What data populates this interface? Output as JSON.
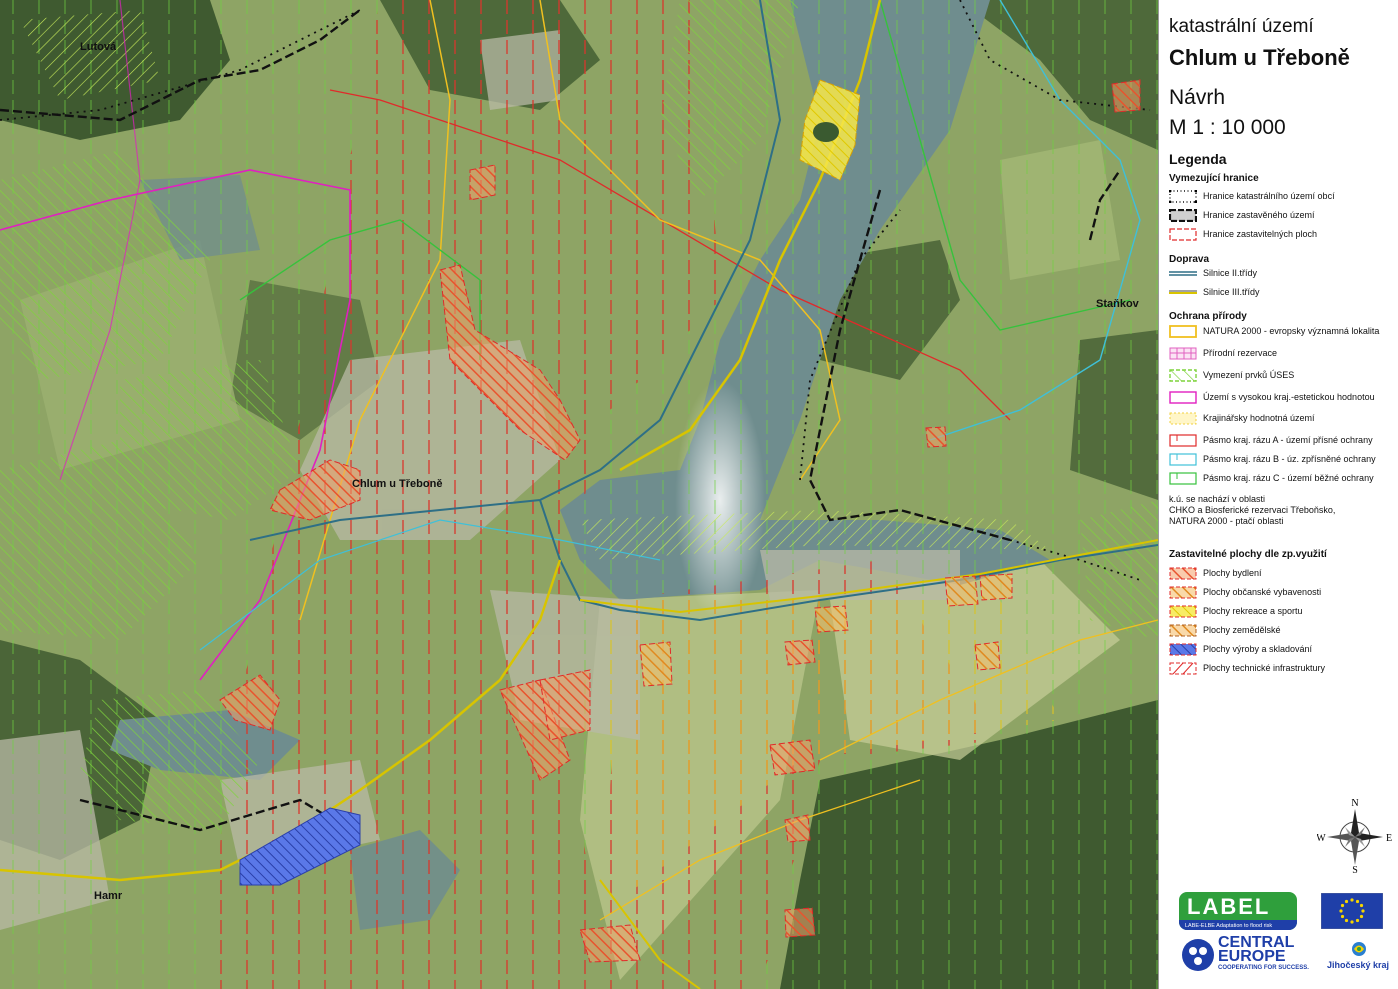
{
  "map": {
    "places": [
      {
        "name": "Lutová"
      },
      {
        "name": "Chlum u Třeboně"
      },
      {
        "name": "Staňkov"
      },
      {
        "name": "Hamr"
      }
    ]
  },
  "header": {
    "line1": "katastrální území",
    "line2": "Chlum u Třeboně",
    "line3": "Návrh",
    "line4": "M 1 : 10 000"
  },
  "legend": {
    "title": "Legenda",
    "sections": [
      {
        "title": "Vymezující hranice",
        "items": [
          {
            "label": "Hranice katastrálního území obcí",
            "symbol": "cadastral-boundary"
          },
          {
            "label": "Hranice zastavěného území",
            "symbol": "built-up-boundary"
          },
          {
            "label": "Hranice zastavitelných ploch",
            "symbol": "buildable-boundary"
          }
        ]
      },
      {
        "title": "Doprava",
        "items": [
          {
            "label": "Silnice II.třídy",
            "symbol": "road-class-2"
          },
          {
            "label": "Silnice III.třídy",
            "symbol": "road-class-3"
          }
        ]
      },
      {
        "title": "Ochrana přírody",
        "items": [
          {
            "label": "NATURA 2000 - evropsky významná lokalita",
            "symbol": "natura-2000"
          },
          {
            "label": "Přírodní rezervace",
            "symbol": "nature-reserve"
          },
          {
            "label": "Vymezení prvků ÚSES",
            "symbol": "uses-elements"
          },
          {
            "label": "Území s vysokou kraj.-estetickou hodnotou",
            "symbol": "aesthetic-value-area"
          },
          {
            "label": "Krajinářsky hodnotná území",
            "symbol": "landscape-valuable-area"
          },
          {
            "label": "Pásmo kraj. rázu A - území přísné ochrany",
            "symbol": "zone-a"
          },
          {
            "label": "Pásmo kraj. rázu B - úz. zpřísněné ochrany",
            "symbol": "zone-b"
          },
          {
            "label": "Pásmo kraj. rázu C - území běžné ochrany",
            "symbol": "zone-c"
          }
        ]
      },
      {
        "title": "Zastavitelné plochy dle zp.využití",
        "items": [
          {
            "label": "Plochy bydlení",
            "symbol": "housing"
          },
          {
            "label": "Plochy občanské vybavenosti",
            "symbol": "civic-amenities"
          },
          {
            "label": "Plochy rekreace a sportu",
            "symbol": "recreation-sport"
          },
          {
            "label": "Plochy zemědělské",
            "symbol": "agricultural"
          },
          {
            "label": "Plochy výroby a skladování",
            "symbol": "production-storage"
          },
          {
            "label": "Plochy  technické infrastruktury",
            "symbol": "technical-infrastructure"
          }
        ]
      }
    ],
    "note": "k.ú. se nachází v oblasti\nCHKO a Biosferické rezervaci Třeboňsko,\nNATURA 2000 - ptačí oblasti"
  },
  "compass": {
    "n": "N",
    "s": "S",
    "e": "E",
    "w": "W"
  },
  "logos": {
    "label_name": "LABEL",
    "label_subtitle": "LABE-ELBE Adaptation to flood risk",
    "central_europe_line1": "CENTRAL",
    "central_europe_line2": "EUROPE",
    "central_europe_line3": "COOPERATING FOR SUCCESS.",
    "region": "Jihočeský kraj"
  },
  "colors": {
    "housing": "#e8542e",
    "civic": "#f0a030",
    "recreation": "#f7e84a",
    "agricultural": "#d98a3a",
    "production": "#3e5bd8",
    "zone_a": "#e02a2a",
    "zone_b": "#3fc0d8",
    "zone_c": "#36c23c",
    "natura": "#f0c020",
    "aesthetic": "#e020c0",
    "road2": "#2e6f86",
    "road3": "#d8c400",
    "water": "#6f8d8e",
    "eu_blue": "#1f3fa8",
    "label_green": "#2f9f3c"
  }
}
